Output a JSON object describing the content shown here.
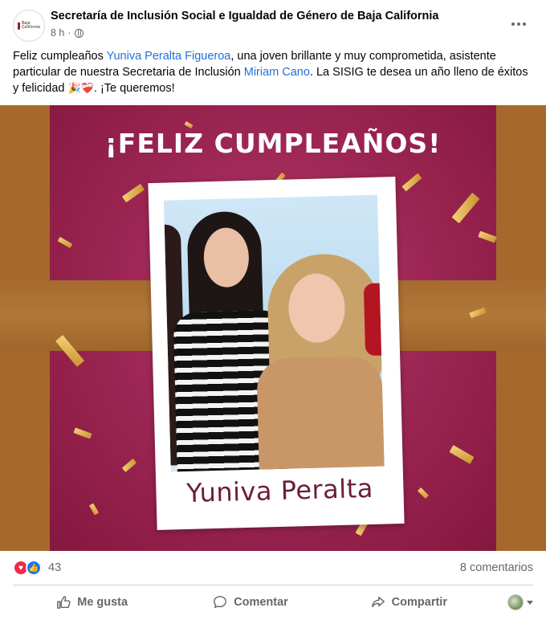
{
  "post": {
    "page_name": "Secretaría de Inclusión Social e Igualdad de Género de Baja California",
    "avatar_logo_text": "Baja California",
    "time": "8 h",
    "separator": "·",
    "text": {
      "p1": "Feliz cumpleaños ",
      "mention1": "Yuniva Peralta Figueroa",
      "p2": ", una joven brillante y muy comprometida, asistente particular de nuestra Secretaria de Inclusión ",
      "mention2": "Miriam Cano",
      "p3": ". La SISIG te desea un año lleno de éxitos y felicidad ",
      "emoji": "🎉❤️‍🩹",
      "p4": ". ¡Te queremos!"
    },
    "image": {
      "title": "¡FELIZ CUMPLEAÑOS!",
      "name_label": "Yuniva Peralta"
    },
    "reactions": {
      "count": "43",
      "icons": [
        "love-icon",
        "like-icon"
      ]
    },
    "comments": "8 comentarios",
    "actions": {
      "like": "Me gusta",
      "comment": "Comentar",
      "share": "Compartir"
    }
  },
  "colors": {
    "link": "#216fdb",
    "card_magenta": "#9d2a53",
    "ribbon_gold": "#a7682b",
    "name_text": "#6d1d35",
    "like_blue": "#1877f2",
    "love_red": "#f0284a"
  }
}
